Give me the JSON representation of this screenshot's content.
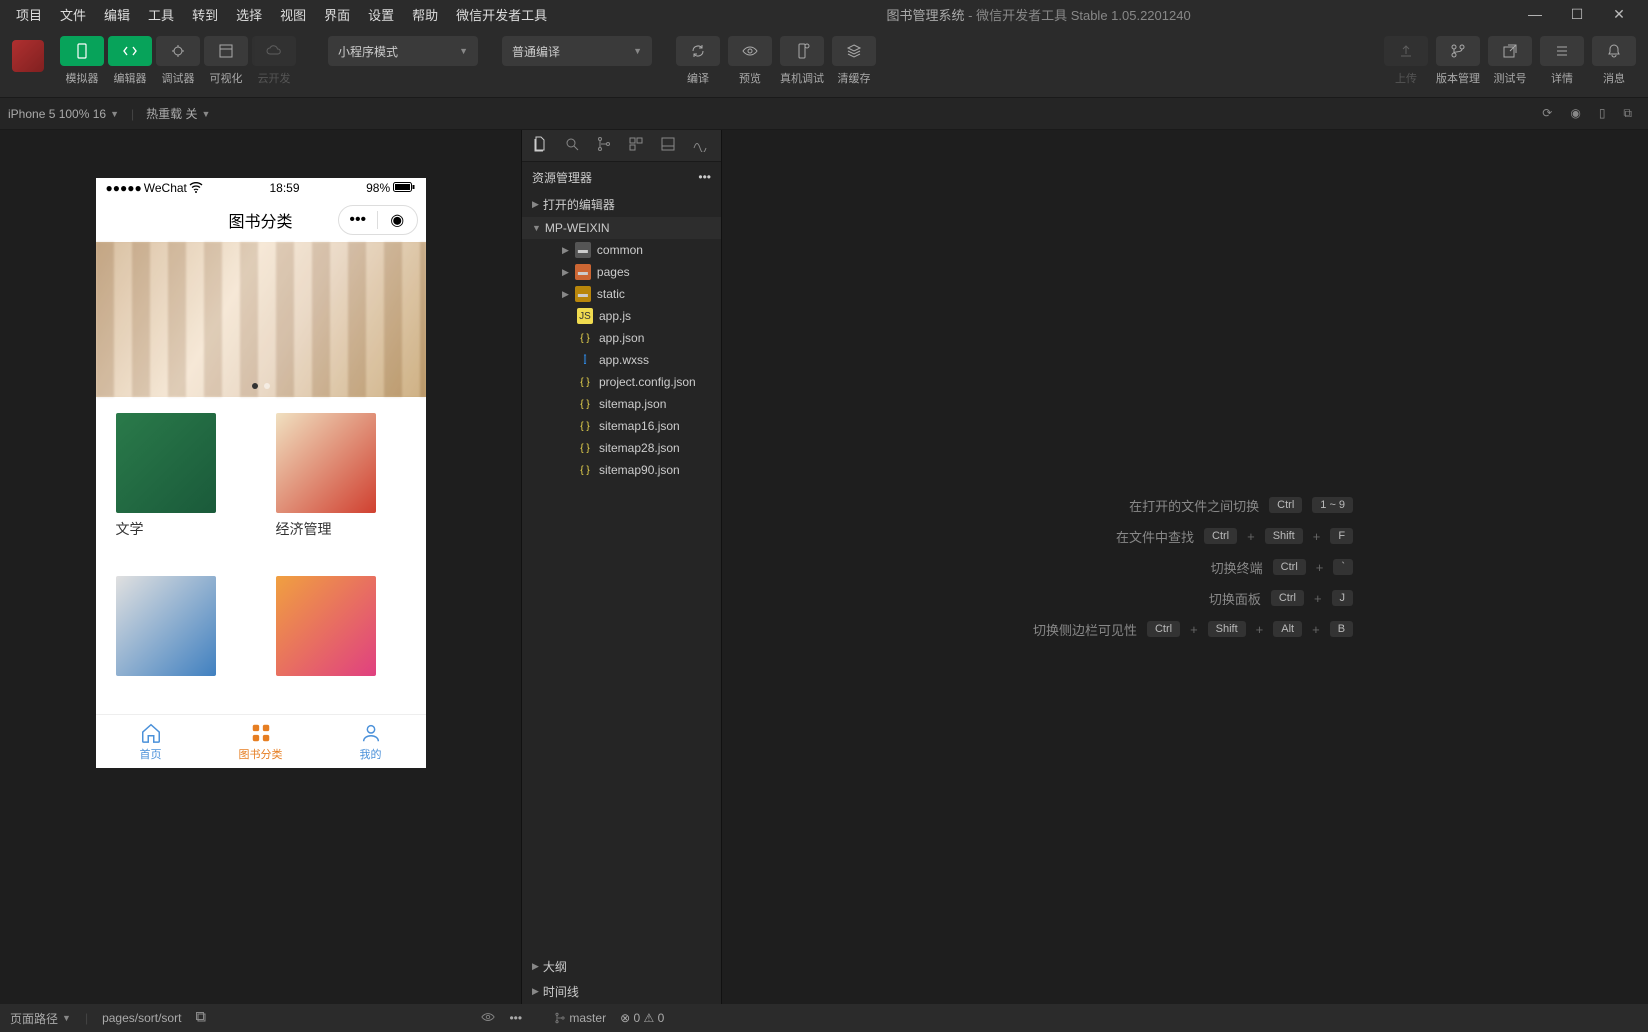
{
  "title": {
    "project": "图书管理系统",
    "app": "微信开发者工具 Stable 1.05.2201240"
  },
  "menu": [
    "项目",
    "文件",
    "编辑",
    "工具",
    "转到",
    "选择",
    "视图",
    "界面",
    "设置",
    "帮助",
    "微信开发者工具"
  ],
  "toolbar": {
    "modeLabels": [
      "模拟器",
      "编辑器",
      "调试器",
      "可视化",
      "云开发"
    ],
    "dropdown1": "小程序模式",
    "dropdown2": "普通编译",
    "compile": "编译",
    "preview": "预览",
    "realdebug": "真机调试",
    "clearcache": "清缓存",
    "upload": "上传",
    "version": "版本管理",
    "testnum": "测试号",
    "details": "详情",
    "message": "消息"
  },
  "subbar": {
    "device": "iPhone 5 100% 16",
    "hotreload": "热重载 关"
  },
  "simulator": {
    "status": {
      "carrier": "WeChat",
      "time": "18:59",
      "battery": "98%"
    },
    "navTitle": "图书分类",
    "categories": [
      {
        "label": "文学"
      },
      {
        "label": "经济管理"
      },
      {
        "label": ""
      },
      {
        "label": ""
      }
    ],
    "tabs": [
      "首页",
      "图书分类",
      "我的"
    ]
  },
  "explorer": {
    "title": "资源管理器",
    "openEditors": "打开的编辑器",
    "project": "MP-WEIXIN",
    "folders": [
      {
        "name": "common",
        "cls": ""
      },
      {
        "name": "pages",
        "cls": "o"
      },
      {
        "name": "static",
        "cls": "y"
      }
    ],
    "files": [
      {
        "name": "app.js",
        "cls": "js"
      },
      {
        "name": "app.json",
        "cls": "json"
      },
      {
        "name": "app.wxss",
        "cls": "wxss"
      },
      {
        "name": "project.config.json",
        "cls": "json"
      },
      {
        "name": "sitemap.json",
        "cls": "json"
      },
      {
        "name": "sitemap16.json",
        "cls": "json"
      },
      {
        "name": "sitemap28.json",
        "cls": "json"
      },
      {
        "name": "sitemap90.json",
        "cls": "json"
      }
    ],
    "outline": "大纲",
    "timeline": "时间线"
  },
  "hints": [
    {
      "label": "在打开的文件之间切换",
      "keys": [
        "Ctrl",
        "1 ~ 9"
      ]
    },
    {
      "label": "在文件中查找",
      "keys": [
        "Ctrl",
        "+",
        "Shift",
        "+",
        "F"
      ]
    },
    {
      "label": "切换终端",
      "keys": [
        "Ctrl",
        "+",
        "`"
      ]
    },
    {
      "label": "切换面板",
      "keys": [
        "Ctrl",
        "+",
        "J"
      ]
    },
    {
      "label": "切换侧边栏可见性",
      "keys": [
        "Ctrl",
        "+",
        "Shift",
        "+",
        "Alt",
        "+",
        "B"
      ]
    }
  ],
  "status": {
    "pathLabel": "页面路径",
    "path": "pages/sort/sort",
    "branch": "master",
    "errors": "0",
    "warnings": "0"
  }
}
